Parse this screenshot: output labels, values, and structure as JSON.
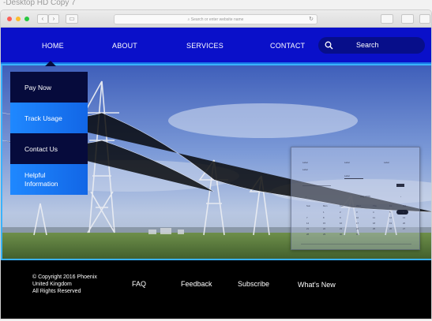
{
  "frame": {
    "title": "-Desktop HD Copy 7"
  },
  "browser": {
    "url_placeholder": "Search or enter website name"
  },
  "nav": {
    "links": [
      "HOME",
      "ABOUT",
      "SERVICES",
      "CONTACT"
    ],
    "search_placeholder": "Search",
    "active": "HOME"
  },
  "dropdown": {
    "items": [
      "Pay Now",
      "Track Usage",
      "Contact Us",
      "Helpful\nInformation"
    ]
  },
  "widget": {
    "labels": [
      "Label",
      "Label",
      "Label",
      "Label",
      "Label"
    ],
    "month": "Aug 2016",
    "weekdays": [
      "Sun",
      "Mon",
      "Tue",
      "Wed",
      "Thu",
      "Fri",
      "Sat"
    ],
    "days": [
      [
        "",
        "1",
        "2",
        "3",
        "4",
        "5",
        "6"
      ],
      [
        "7",
        "8",
        "9",
        "10",
        "11",
        "12",
        "13"
      ],
      [
        "14",
        "15",
        "16",
        "17",
        "18",
        "19",
        "20"
      ],
      [
        "21",
        "22",
        "23",
        "24",
        "25",
        "26",
        "27"
      ],
      [
        "28",
        "29",
        "30",
        "31",
        "",
        "",
        ""
      ]
    ]
  },
  "footer": {
    "copyright": "© Copyright 2016 Phoenix\nUnited Kingdom\nAll Rights Reserved",
    "links": [
      "FAQ",
      "Feedback",
      "Subscribe",
      "What's New"
    ]
  },
  "colors": {
    "nav_bg": "#0a10c9",
    "search_bg": "#070e8a",
    "dropdown_dark": "#060b3c",
    "dropdown_blue": "#1f88ff",
    "hero_border": "#3ab2ff",
    "footer_bg": "#000000"
  }
}
